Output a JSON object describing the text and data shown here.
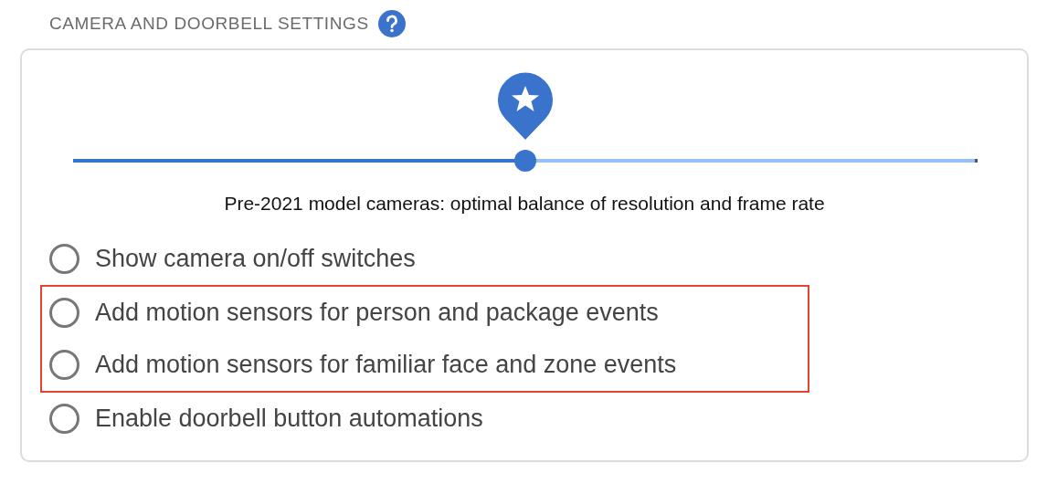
{
  "section": {
    "title": "CAMERA AND DOORBELL SETTINGS"
  },
  "slider": {
    "level": 0.5,
    "caption": "Pre-2021 model cameras: optimal balance of resolution and frame rate"
  },
  "options": [
    {
      "kind": "option",
      "label": "Show camera on/off switches",
      "checked": false
    },
    {
      "kind": "highlight",
      "items": [
        {
          "label": "Add motion sensors for person and package events",
          "checked": false
        },
        {
          "label": "Add motion sensors for familiar face and zone events",
          "checked": false
        }
      ]
    },
    {
      "kind": "option",
      "label": "Enable doorbell button automations",
      "checked": false
    }
  ]
}
